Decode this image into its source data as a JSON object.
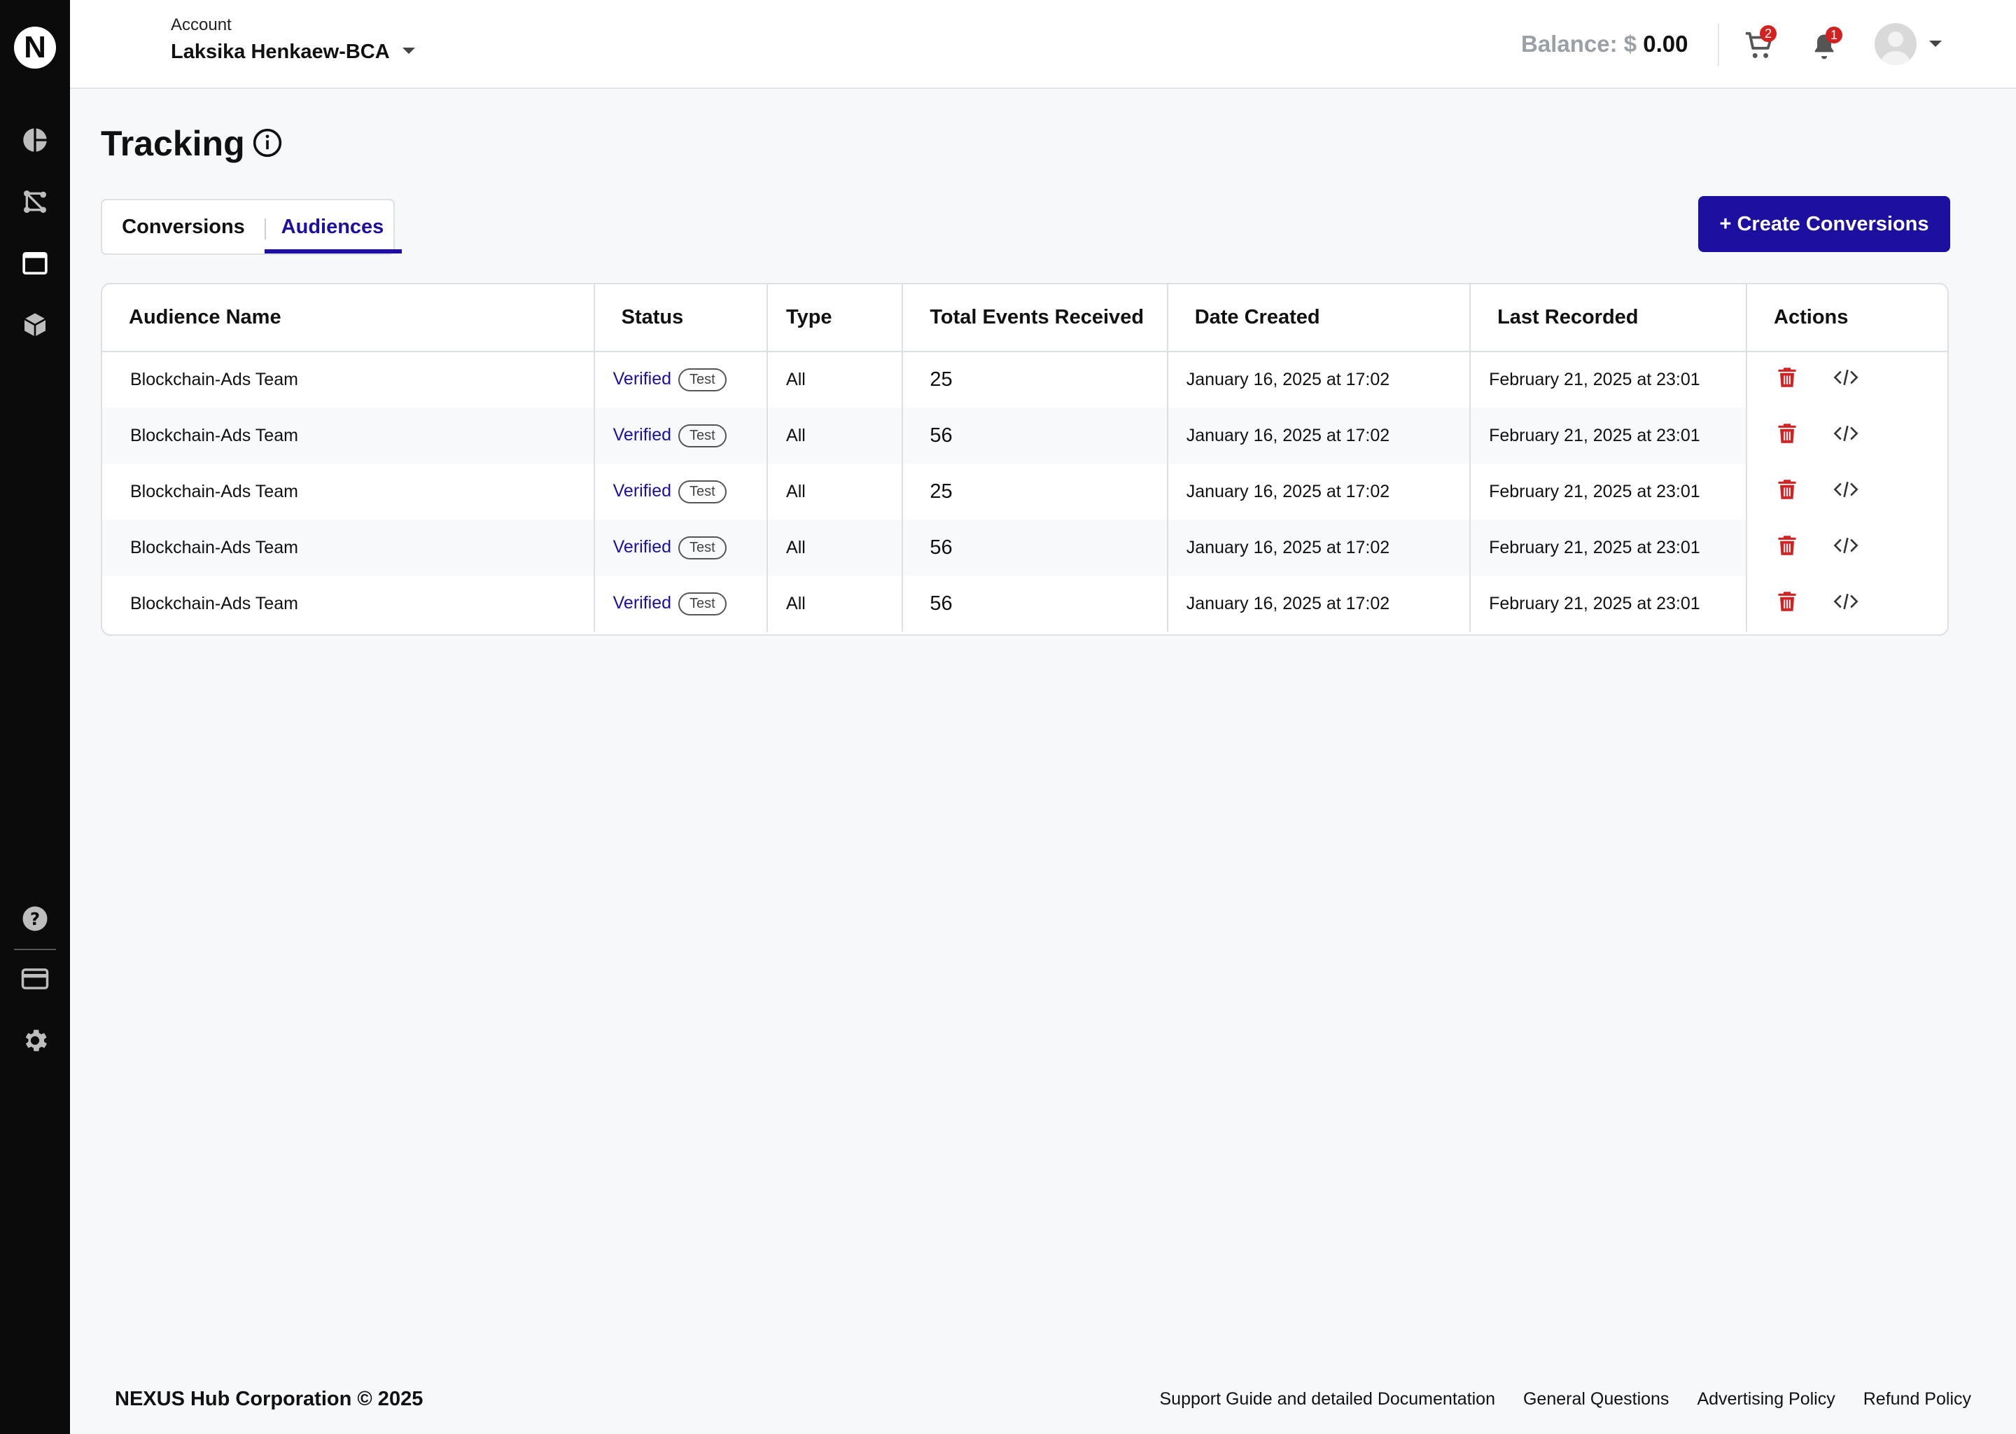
{
  "header": {
    "account_label": "Account",
    "account_name": "Laksika Henkaew-BCA",
    "balance_label": "Balance: $",
    "balance_amount": "0.00",
    "cart_count": "2",
    "notification_count": "1"
  },
  "page": {
    "title": "Tracking"
  },
  "tabs": [
    {
      "label": "Conversions",
      "active": false
    },
    {
      "label": "Audiences",
      "active": true
    }
  ],
  "create_button_label": "+ Create Conversions",
  "table": {
    "columns": [
      "Audience Name",
      "Status",
      "Type",
      "Total Events Received",
      "Date Created",
      "Last Recorded",
      "Actions"
    ],
    "rows": [
      {
        "name": "Blockchain-Ads Team",
        "status": "Verified",
        "tag": "Test",
        "type": "All",
        "events": "25",
        "created": "January 16, 2025 at 17:02",
        "recorded": "February 21, 2025 at 23:01"
      },
      {
        "name": "Blockchain-Ads Team",
        "status": "Verified",
        "tag": "Test",
        "type": "All",
        "events": "56",
        "created": "January 16, 2025 at 17:02",
        "recorded": "February 21, 2025 at 23:01"
      },
      {
        "name": "Blockchain-Ads Team",
        "status": "Verified",
        "tag": "Test",
        "type": "All",
        "events": "25",
        "created": "January 16, 2025 at 17:02",
        "recorded": "February 21, 2025 at 23:01"
      },
      {
        "name": "Blockchain-Ads Team",
        "status": "Verified",
        "tag": "Test",
        "type": "All",
        "events": "56",
        "created": "January 16, 2025 at 17:02",
        "recorded": "February 21, 2025 at 23:01"
      },
      {
        "name": "Blockchain-Ads Team",
        "status": "Verified",
        "tag": "Test",
        "type": "All",
        "events": "56",
        "created": "January 16, 2025 at 17:02",
        "recorded": "February 21, 2025 at 23:01"
      }
    ]
  },
  "footer": {
    "copyright": "NEXUS Hub Corporation © 2025",
    "links": [
      "Support Guide and detailed Documentation",
      "General Questions",
      "Advertising Policy",
      "Refund Policy"
    ]
  },
  "sidebar": {
    "logo_letter": "N",
    "icons": [
      "pie-chart-icon",
      "workflow-icon",
      "window-icon",
      "cube-icon",
      "help-icon",
      "credit-card-icon",
      "gear-icon"
    ]
  },
  "colors": {
    "accent": "#1d0fa0",
    "delete": "#d32121",
    "sidebar_bg": "#0b0b0b"
  }
}
